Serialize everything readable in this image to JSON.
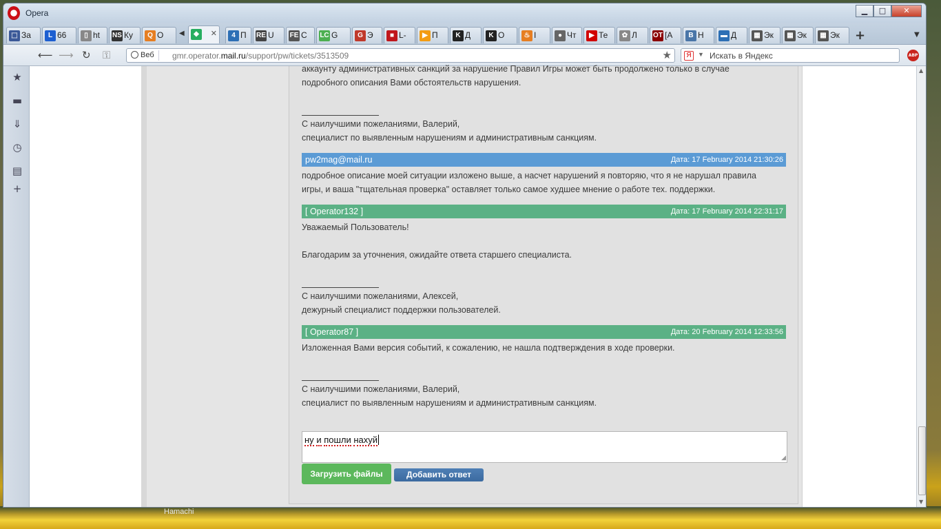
{
  "window": {
    "title": "Opera",
    "controls": {
      "minimize": "▁",
      "maximize": "□",
      "close": "✕"
    }
  },
  "tabs": [
    {
      "label": "За",
      "icon": "favicon-bookmark",
      "color": "#3b5998",
      "glyph": "⬚"
    },
    {
      "label": "66",
      "icon": "favicon-L",
      "color": "#1d5fd1",
      "glyph": "L"
    },
    {
      "label": "ht",
      "icon": "favicon-page",
      "color": "#888888",
      "glyph": "▯"
    },
    {
      "label": "Ку",
      "icon": "favicon-NS",
      "color": "#333333",
      "glyph": "NS"
    },
    {
      "label": "О",
      "icon": "favicon-Q",
      "color": "#e67e22",
      "glyph": "Q"
    },
    {
      "label": "",
      "icon": "favicon-cube",
      "color": "#27ae60",
      "glyph": "◆",
      "active": true
    },
    {
      "label": "П",
      "icon": "favicon-4",
      "color": "#2c6fb5",
      "glyph": "4"
    },
    {
      "label": "U",
      "icon": "favicon-RE",
      "color": "#444444",
      "glyph": "RE"
    },
    {
      "label": "С",
      "icon": "favicon-FE",
      "color": "#555555",
      "glyph": "FE"
    },
    {
      "label": "G",
      "icon": "favicon-LC",
      "color": "#4caf50",
      "glyph": "LC"
    },
    {
      "label": "Э",
      "icon": "favicon-G",
      "color": "#c0392b",
      "glyph": "G"
    },
    {
      "label": "L-",
      "icon": "favicon-red",
      "color": "#c0171c",
      "glyph": "■"
    },
    {
      "label": "П",
      "icon": "favicon-play",
      "color": "#f39c12",
      "glyph": "▶"
    },
    {
      "label": "Д",
      "icon": "favicon-K",
      "color": "#222222",
      "glyph": "K"
    },
    {
      "label": "О",
      "icon": "favicon-K2",
      "color": "#222222",
      "glyph": "K"
    },
    {
      "label": "I",
      "icon": "favicon-java",
      "color": "#e67e22",
      "glyph": "♨"
    },
    {
      "label": "Чт",
      "icon": "favicon-circle",
      "color": "#666666",
      "glyph": "●"
    },
    {
      "label": "Те",
      "icon": "favicon-youtube",
      "color": "#d10000",
      "glyph": "▶"
    },
    {
      "label": "Л",
      "icon": "favicon-reel",
      "color": "#888888",
      "glyph": "✿"
    },
    {
      "label": "[А",
      "icon": "favicon-OT",
      "color": "#8b0000",
      "glyph": "OT"
    },
    {
      "label": "Н",
      "icon": "favicon-vk",
      "color": "#4a76a8",
      "glyph": "В"
    },
    {
      "label": "Д",
      "icon": "favicon-chat",
      "color": "#2c6fb5",
      "glyph": "▬"
    },
    {
      "label": "Эк",
      "icon": "favicon-grid",
      "color": "#555555",
      "glyph": "▦"
    },
    {
      "label": "Эк",
      "icon": "favicon-grid2",
      "color": "#555555",
      "glyph": "▦"
    },
    {
      "label": "Эк",
      "icon": "favicon-grid3",
      "color": "#555555",
      "glyph": "▦"
    }
  ],
  "address": {
    "mode_label": "Веб",
    "url_prefix": "gmr.operator.",
    "url_domain": "mail.ru",
    "url_path": "/support/pw/tickets/3513509",
    "search_badge": "Я",
    "search_placeholder": "Искать в Яндекс",
    "abp": "ABP"
  },
  "messages": {
    "top_cut_line1": "аккаунту административных санкций за нарушение Правил Игры может быть продолжено только в случае",
    "top_cut_line2": "подробного описания Вами обстоятельств нарушения.",
    "top_sig_line1": "С наилучшими пожеланиями, Валерий,",
    "top_sig_line2": "специалист по выявленным нарушениям и административным санкциям.",
    "m1_author": "pw2mag@mail.ru",
    "m1_date": "Дата: 17 February 2014 21:30:26",
    "m1_line1": "подробное описание моей ситуации изложено выше, а насчет нарушений я повторяю, что я не нарушал правила",
    "m1_line2": "игры, и ваша \"тщательная проверка\" оставляет только самое худшее мнение о работе тех. поддержки.",
    "m2_author": "[ Operator132 ]",
    "m2_date": "Дата: 17 February 2014 22:31:17",
    "m2_line1": "Уважаемый Пользователь!",
    "m2_line2": "Благодарим за уточнения, ожидайте ответа старшего специалиста.",
    "m2_sig1": "С наилучшими пожеланиями, Алексей,",
    "m2_sig2": "дежурный специалист поддержки пользователей.",
    "m3_author": "[ Operator87 ]",
    "m3_date": "Дата: 20 February 2014 12:33:56",
    "m3_line1": "Изложенная Вами версия событий, к сожалению, не нашла подтверждения в ходе проверки.",
    "m3_sig1": "С наилучшими пожеланиями, Валерий,",
    "m3_sig2": "специалист по выявленным нарушениям и административным санкциям."
  },
  "reply": {
    "text_word1": "ну",
    "text_word2": "и",
    "text_word3": "пошли",
    "text_word4": "нахуй",
    "upload_button": "Загрузить файлы",
    "submit_button": "Добавить ответ"
  },
  "taskbar": {
    "hamachi_label": "Hamachi"
  },
  "colors": {
    "user_header": "#5b9bd5",
    "operator_header": "#5bb185",
    "upload_button": "#5cb85c",
    "submit_button": "#3b6aa0"
  }
}
